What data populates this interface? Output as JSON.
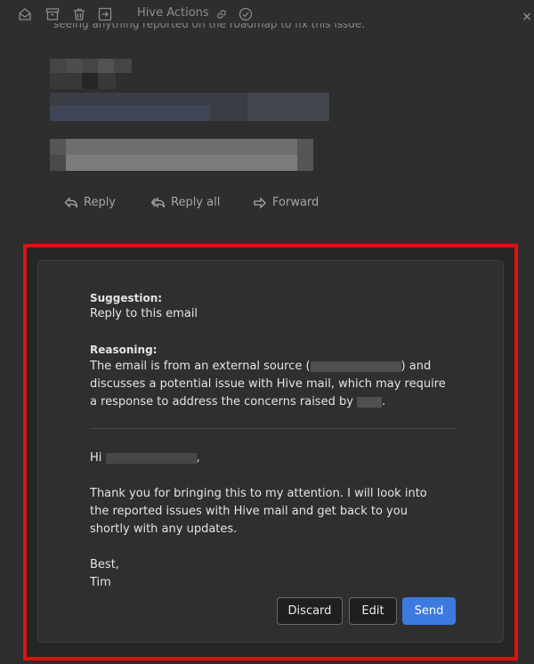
{
  "toolbar": {
    "actions_label": "Hive Actions",
    "icons": [
      "mail-open-icon",
      "archive-icon",
      "trash-icon",
      "move-to-icon",
      "link-icon",
      "check-circle-icon"
    ],
    "close_label": "×"
  },
  "email": {
    "cut_text": "seeing anything reported on the roadmap to fix this issue."
  },
  "reply_bar": {
    "reply": "Reply",
    "reply_all": "Reply all",
    "forward": "Forward"
  },
  "suggestion": {
    "suggestion_heading": "Suggestion:",
    "suggestion_text": "Reply to this email",
    "reasoning_heading": "Reasoning:",
    "reasoning_line1_a": "The email is from an external source (",
    "reasoning_line1_b": ") and",
    "reasoning_line2": "discusses a potential issue with Hive mail, which may require",
    "reasoning_line3_a": "a response to address the concerns raised by",
    "reasoning_line3_b": "."
  },
  "draft": {
    "greeting_a": "Hi",
    "greeting_b": ",",
    "body_line1": "Thank you for bringing this to my attention. I will look into",
    "body_line2": "the reported issues with Hive mail and get back to you",
    "body_line3": "shortly with any updates.",
    "signoff": "Best,",
    "signature": "Tim"
  },
  "buttons": {
    "discard": "Discard",
    "edit": "Edit",
    "send": "Send"
  },
  "colors": {
    "background": "#2e2e2e",
    "highlight_frame": "#e01010",
    "primary_button": "#3b7be0"
  }
}
